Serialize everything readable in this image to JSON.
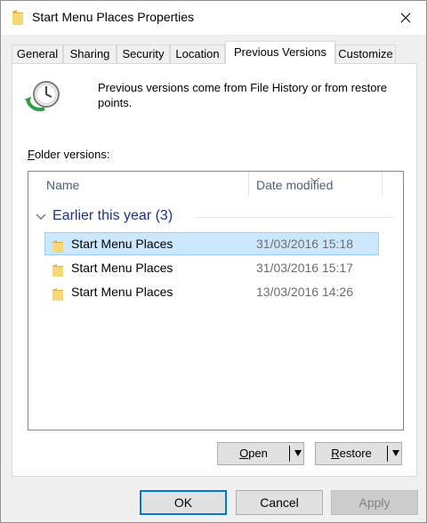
{
  "window": {
    "title": "Start Menu Places Properties"
  },
  "tabs": [
    {
      "label": "General"
    },
    {
      "label": "Sharing"
    },
    {
      "label": "Security"
    },
    {
      "label": "Location"
    },
    {
      "label": "Previous Versions",
      "active": true
    },
    {
      "label": "Customize"
    }
  ],
  "intro": {
    "text": "Previous versions come from File History or from restore points."
  },
  "folder_versions": {
    "label_accel": "F",
    "label_rest": "older versions:",
    "columns": {
      "name": "Name",
      "date_modified": "Date modified"
    },
    "group": {
      "label": "Earlier this year (3)"
    },
    "rows": [
      {
        "name": "Start Menu Places",
        "date": "31/03/2016 15:18",
        "selected": true
      },
      {
        "name": "Start Menu Places",
        "date": "31/03/2016 15:17"
      },
      {
        "name": "Start Menu Places",
        "date": "13/03/2016 14:26"
      }
    ]
  },
  "actions": {
    "open_accel": "O",
    "open_rest": "pen",
    "restore_accel": "R",
    "restore_rest": "estore"
  },
  "footer": {
    "ok": "OK",
    "cancel": "Cancel",
    "apply": "Apply"
  },
  "colors": {
    "accent": "#0078d7",
    "selection": "#cce8ff",
    "group_header": "#1e3287",
    "folder": "#f8d775"
  }
}
